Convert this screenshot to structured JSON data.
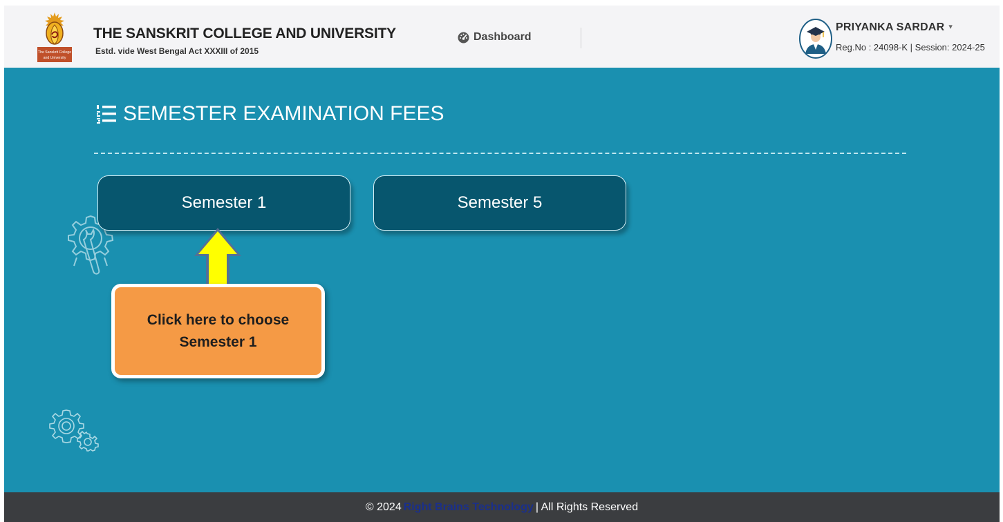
{
  "header": {
    "logo_caption": "The Sanskrit College and University",
    "title": "THE SANSKRIT COLLEGE AND UNIVERSITY",
    "subtitle": "Estd. vide West Bengal Act XXXIII of 2015",
    "nav": {
      "dashboard_label": "Dashboard",
      "dashboard_icon": "dashboard-gauge-icon"
    },
    "user": {
      "name": "PRIYANKA SARDAR",
      "meta": "Reg.No : 24098-K | Session: 2024-25",
      "caret": "▾"
    }
  },
  "main": {
    "title": "SEMESTER EXAMINATION FEES",
    "title_icon": "ordered-list-icon",
    "semesters": [
      {
        "label": "Semester 1"
      },
      {
        "label": "Semester 5"
      }
    ],
    "callout": {
      "line1": "Click here to choose",
      "line2": "Semester 1"
    }
  },
  "footer": {
    "prefix": "© 2024",
    "link_text": "Right Brains Technology",
    "suffix": "| All Rights Reserved"
  },
  "colors": {
    "main_bg": "#1a90b0",
    "button_bg": "#07566e",
    "callout_bg": "#f59a45",
    "arrow_fill": "#ffff00",
    "footer_bg": "#3b3d40",
    "footer_link": "#1a2f8c"
  }
}
